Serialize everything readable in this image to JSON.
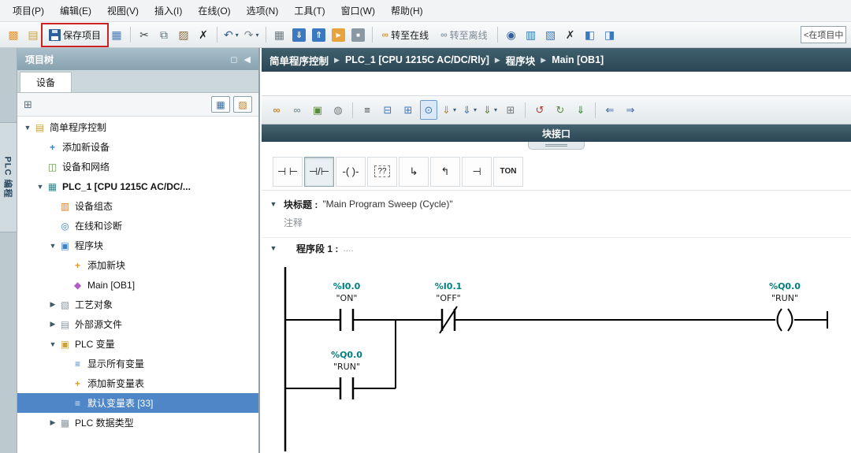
{
  "menu": {
    "items": [
      "项目(P)",
      "编辑(E)",
      "视图(V)",
      "插入(I)",
      "在线(O)",
      "选项(N)",
      "工具(T)",
      "窗口(W)",
      "帮助(H)"
    ]
  },
  "main_toolbar": {
    "glyphs": {
      "new-project": "▩",
      "open-project": "▤",
      "print": "▦",
      "cut": "✂",
      "copy": "⧉",
      "paste": "▨",
      "delete": "✗",
      "undo": "↶",
      "redo": "↷",
      "dropdown-caret": "▾",
      "compile": "▦",
      "download": "⇓",
      "upload": "⇑",
      "start-cpu": "▶",
      "stop-cpu": "■",
      "glasses": "∞",
      "accessible-devices": "◉",
      "alarms": "▥",
      "info": "▧",
      "cancel": "✗",
      "split-left": "◧",
      "split-right": "◨"
    },
    "save_label": "保存项目",
    "go_online_label": "转至在线",
    "go_offline_label": "转至离线",
    "search_value": "<在项目中搜"
  },
  "side_tab": {
    "label": "PLC 编程"
  },
  "project_tree": {
    "title": "项目树",
    "tab_label": "设备",
    "glyphs": {
      "pin": "◻",
      "collapse": "◀",
      "tree-view": "⊞",
      "list-view": "▦",
      "diagram-view": "▨"
    },
    "items": [
      {
        "arrow": "▼",
        "glyph": "▤",
        "label": "简单程序控制"
      },
      {
        "arrow": "",
        "glyph": "+",
        "label": "添加新设备"
      },
      {
        "arrow": "",
        "glyph": "◫",
        "label": "设备和网络"
      },
      {
        "arrow": "▼",
        "glyph": "▦",
        "label": "PLC_1 [CPU 1215C AC/DC/..."
      },
      {
        "arrow": "",
        "glyph": "▥",
        "label": "设备组态"
      },
      {
        "arrow": "",
        "glyph": "◎",
        "label": "在线和诊断"
      },
      {
        "arrow": "▼",
        "glyph": "▣",
        "label": "程序块"
      },
      {
        "arrow": "",
        "glyph": "+",
        "label": "添加新块"
      },
      {
        "arrow": "",
        "glyph": "◆",
        "label": "Main [OB1]"
      },
      {
        "arrow": "▶",
        "glyph": "▧",
        "label": "工艺对象"
      },
      {
        "arrow": "▶",
        "glyph": "▤",
        "label": "外部源文件"
      },
      {
        "arrow": "▼",
        "glyph": "▣",
        "label": "PLC 变量"
      },
      {
        "arrow": "",
        "glyph": "≡",
        "label": "显示所有变量"
      },
      {
        "arrow": "",
        "glyph": "+",
        "label": "添加新变量表"
      },
      {
        "arrow": "",
        "glyph": "≡",
        "label": "默认变量表 [33]"
      },
      {
        "arrow": "▶",
        "glyph": "▦",
        "label": "PLC 数据类型"
      }
    ]
  },
  "editor": {
    "breadcrumb": [
      "简单程序控制",
      "PLC_1 [CPU 1215C AC/DC/Rly]",
      "程序块",
      "Main [OB1]"
    ],
    "crumb_sep": "▶",
    "glyphs": {
      "monitor-on": "∞",
      "monitor-off": "∞",
      "retain": "▣",
      "snapshot": "◍",
      "absolute": "≡",
      "collapse-all": "⊟",
      "expand-all": "⊞",
      "comment": "⊙",
      "insert-network": "⇓",
      "insert-row": "⇓",
      "insert-box": "⇓",
      "grid": "⊞",
      "rotate-ccw": "↺",
      "rotate-cw": "↻",
      "sync": "⇓",
      "jump-back": "⇐",
      "jump-fwd": "⇒",
      "caret": "▾"
    },
    "block_interface_label": "块接口",
    "favorites": {
      "no-contact": "⊣ ⊢",
      "nc-contact": "⊣/⊢",
      "coil": "-( )-",
      "empty-box": "??",
      "open-branch": "↳",
      "close-branch": "↰",
      "contact-end": "⊣",
      "ton": "TON"
    },
    "expander": "▼",
    "block_title_label": "块标题 :",
    "block_title": "\"Main Program Sweep (Cycle)\"",
    "comment": "注释",
    "network_label": "程序段 1 :",
    "network_dots": "....",
    "ladder": {
      "elements": [
        {
          "type": "no-contact",
          "address": "%I0.0",
          "symbol": "\"ON\""
        },
        {
          "type": "nc-contact",
          "address": "%I0.1",
          "symbol": "\"OFF\""
        },
        {
          "type": "coil",
          "address": "%Q0.0",
          "symbol": "\"RUN\""
        },
        {
          "type": "no-contact",
          "address": "%Q0.0",
          "symbol": "\"RUN\""
        }
      ]
    }
  },
  "colors": {
    "header_bar": "#2b4654",
    "selection": "#4e86c8",
    "operand": "#008080",
    "annotation": "#cc2222"
  }
}
